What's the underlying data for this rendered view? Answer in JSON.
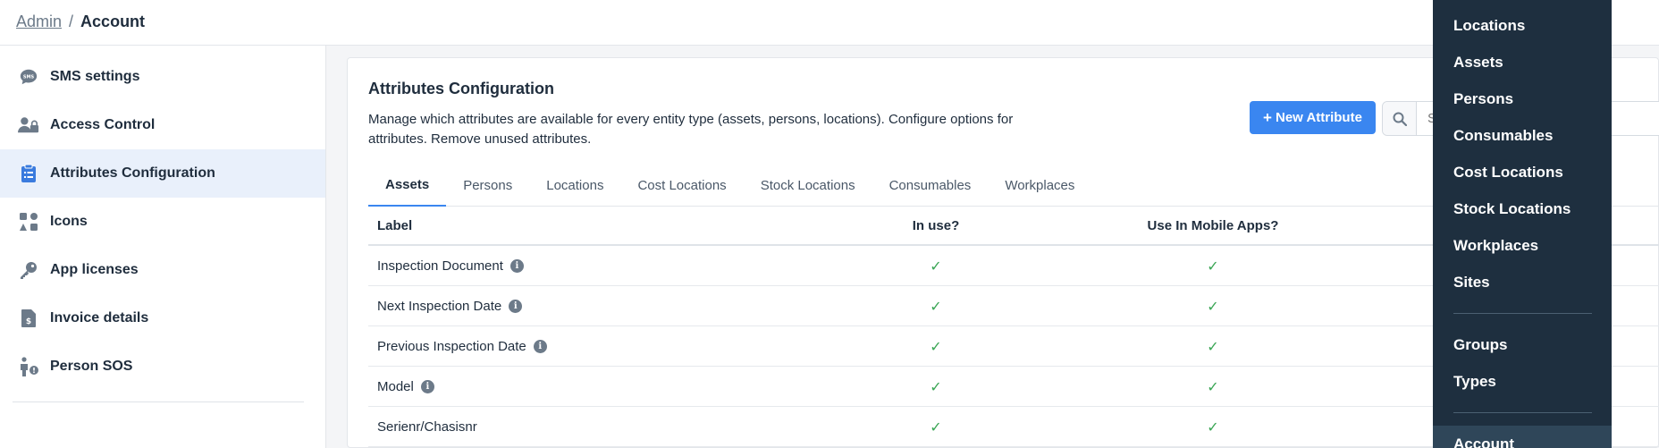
{
  "breadcrumb": {
    "parent": "Admin",
    "separator": "/",
    "current": "Account"
  },
  "sidebar": {
    "items": [
      {
        "label": "SMS settings",
        "icon": "sms-chat-icon",
        "active": false
      },
      {
        "label": "Access Control",
        "icon": "users-lock-icon",
        "active": false
      },
      {
        "label": "Attributes Configuration",
        "icon": "clipboard-list-icon",
        "active": true
      },
      {
        "label": "Icons",
        "icon": "icons-grid-icon",
        "active": false
      },
      {
        "label": "App licenses",
        "icon": "key-icon",
        "active": false
      },
      {
        "label": "Invoice details",
        "icon": "invoice-dollar-icon",
        "active": false
      },
      {
        "label": "Person SOS",
        "icon": "person-alert-icon",
        "active": false
      }
    ]
  },
  "card": {
    "title": "Attributes Configuration",
    "description": "Manage which attributes are available for every entity type (assets, persons, locations). Configure options for attributes. Remove unused attributes.",
    "new_button": "New Attribute",
    "search_placeholder": "Search"
  },
  "tabs": [
    {
      "label": "Assets",
      "active": true
    },
    {
      "label": "Persons",
      "active": false
    },
    {
      "label": "Locations",
      "active": false
    },
    {
      "label": "Cost Locations",
      "active": false
    },
    {
      "label": "Stock Locations",
      "active": false
    },
    {
      "label": "Consumables",
      "active": false
    },
    {
      "label": "Workplaces",
      "active": false
    }
  ],
  "table": {
    "headers": {
      "label": "Label",
      "in_use": "In use?",
      "mobile": "Use In Mobile Apps?"
    },
    "rows": [
      {
        "label": "Inspection Document",
        "info": true,
        "in_use": true,
        "mobile": true
      },
      {
        "label": "Next Inspection Date",
        "info": true,
        "in_use": true,
        "mobile": true
      },
      {
        "label": "Previous Inspection Date",
        "info": true,
        "in_use": true,
        "mobile": true
      },
      {
        "label": "Model",
        "info": true,
        "in_use": true,
        "mobile": true
      },
      {
        "label": "Serienr/Chasisnr",
        "info": false,
        "in_use": true,
        "mobile": true
      }
    ]
  },
  "dropdown": {
    "group1": [
      "Locations",
      "Assets",
      "Persons",
      "Consumables",
      "Cost Locations",
      "Stock Locations",
      "Workplaces",
      "Sites"
    ],
    "group2": [
      "Groups",
      "Types"
    ],
    "group3": [
      "Account"
    ],
    "active": "Account"
  },
  "colors": {
    "primary": "#3a86f0",
    "menu_bg": "#1e2f3f",
    "menu_active": "#2f4659",
    "check_green": "#3aa655",
    "sidebar_active_bg": "#e9f0fb"
  }
}
